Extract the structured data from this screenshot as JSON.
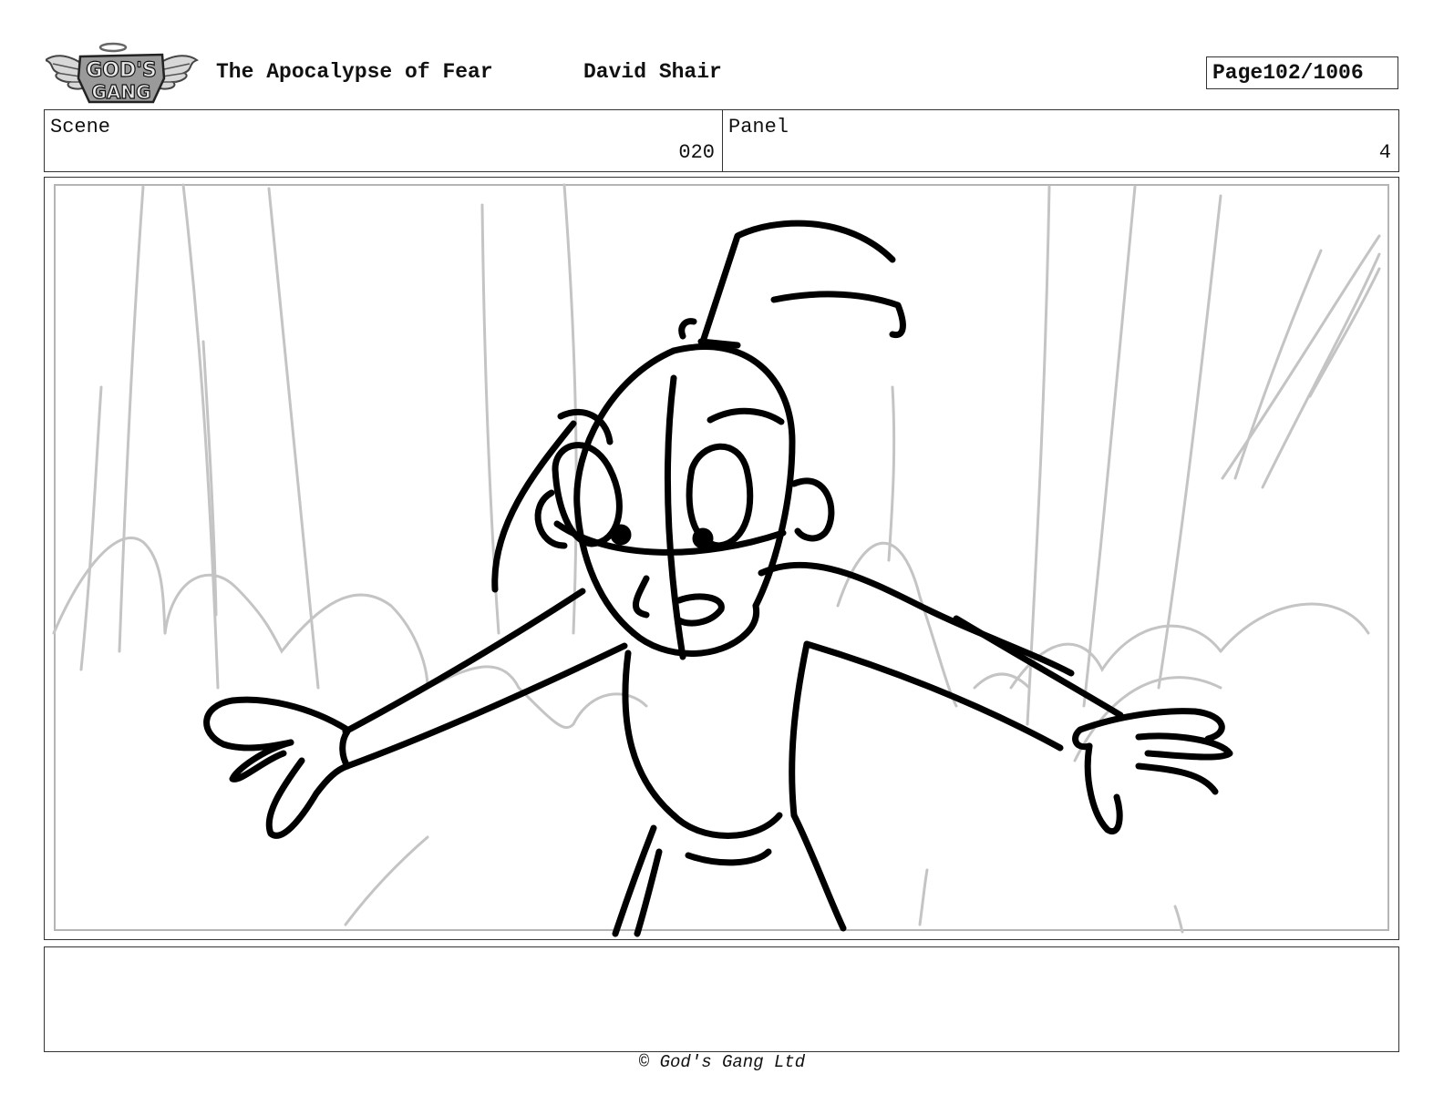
{
  "header": {
    "logo_text_top": "GOD'S",
    "logo_text_bottom": "GANG",
    "show_title": "The Apocalypse of Fear",
    "author": "David Shair",
    "page_label": "Page",
    "page_value": "102/1006"
  },
  "info": {
    "scene_label": "Scene",
    "scene_value": "020",
    "panel_label": "Panel",
    "panel_value": "4"
  },
  "frame": {
    "image_icon": "storyboard-sketch"
  },
  "notes": {
    "text": ""
  },
  "footer": {
    "copyright": "© God's Gang Ltd"
  }
}
